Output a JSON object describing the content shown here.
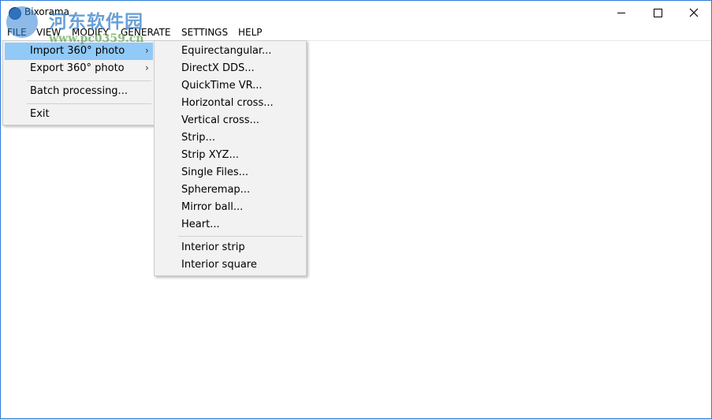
{
  "window": {
    "title": "Bixorama"
  },
  "menubar": [
    {
      "name": "menu-file",
      "label": "FILE"
    },
    {
      "name": "menu-view",
      "label": "VIEW"
    },
    {
      "name": "menu-modify",
      "label": "MODIFY"
    },
    {
      "name": "menu-generate",
      "label": "GENERATE"
    },
    {
      "name": "menu-settings",
      "label": "SETTINGS"
    },
    {
      "name": "menu-help",
      "label": "HELP"
    }
  ],
  "file_menu": {
    "items": [
      {
        "label": "Import 360° photo",
        "has_submenu": true,
        "selected": true
      },
      {
        "label": "Export 360° photo",
        "has_submenu": true
      },
      {
        "label": "Batch processing..."
      },
      {
        "label": "Exit"
      }
    ],
    "arrow": "›"
  },
  "import_submenu": {
    "items": [
      "Equirectangular...",
      "DirectX DDS...",
      "QuickTime VR...",
      "Horizontal cross...",
      "Vertical cross...",
      "Strip...",
      "Strip XYZ...",
      "Single Files...",
      "Spheremap...",
      "Mirror ball...",
      "Heart...",
      "Interior strip",
      "Interior square"
    ]
  },
  "watermark": {
    "text": "河东软件园",
    "url": "www.pc0359.cn"
  },
  "colors": {
    "selection": "#91c9f7",
    "menu_bg": "#f2f2f2",
    "window_border": "#2d7bd6"
  }
}
